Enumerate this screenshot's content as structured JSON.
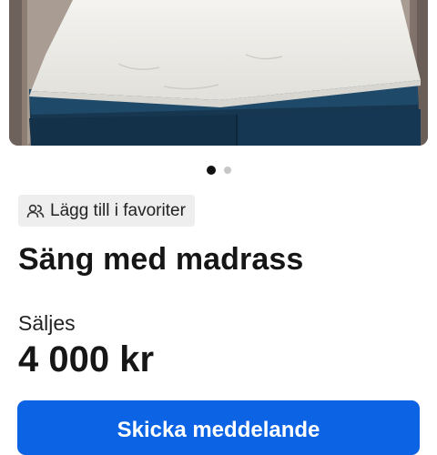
{
  "listing": {
    "image_count": 2,
    "active_image_index": 0,
    "favorite_icon": "users-icon",
    "favorite_label": "Lägg till i favoriter",
    "title": "Säng med madrass",
    "status": "Säljes",
    "price": "4 000 kr"
  },
  "actions": {
    "primary_label": "Skicka meddelande",
    "primary_color": "#0c63e4"
  }
}
